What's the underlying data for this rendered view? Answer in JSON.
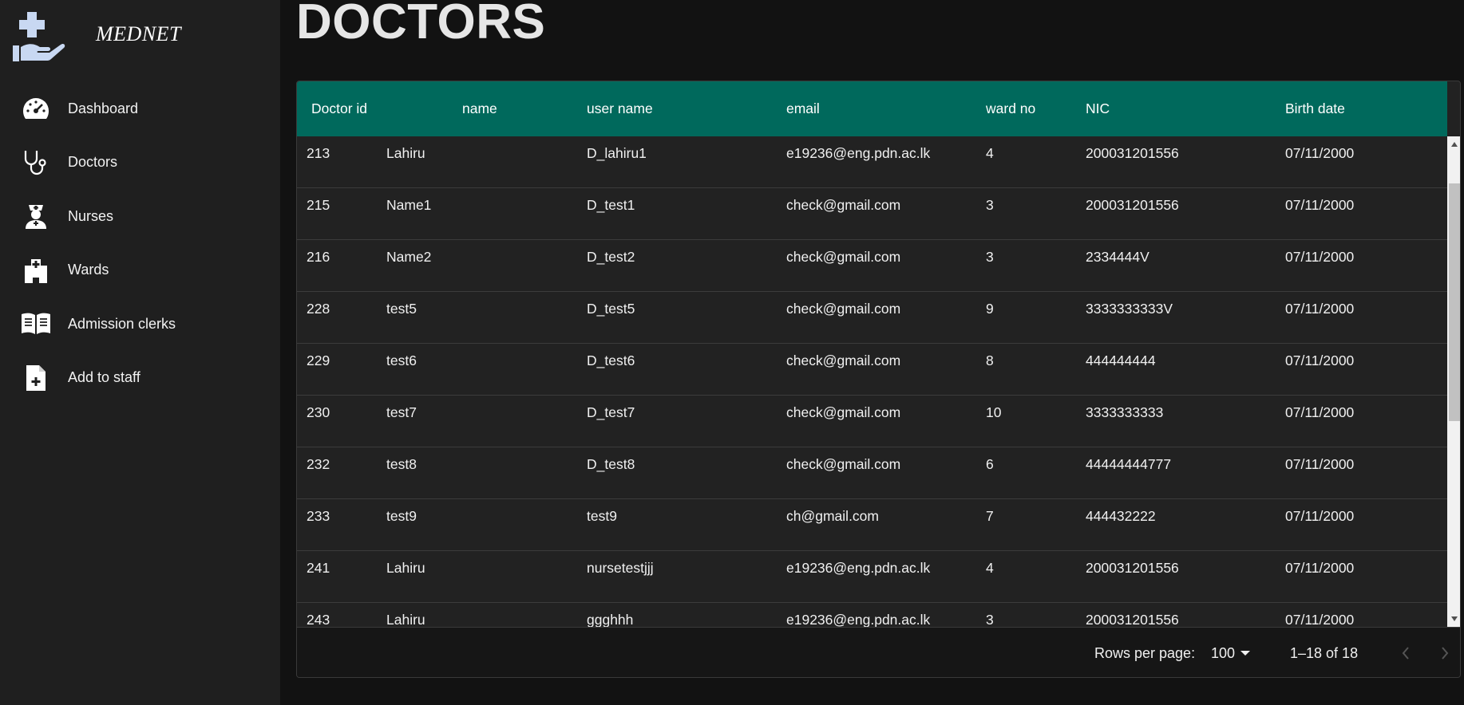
{
  "brand": {
    "name": "MEDNET"
  },
  "sidebar": {
    "items": [
      {
        "label": "Dashboard",
        "icon": "speedometer-icon"
      },
      {
        "label": "Doctors",
        "icon": "stethoscope-icon"
      },
      {
        "label": "Nurses",
        "icon": "nurse-icon"
      },
      {
        "label": "Wards",
        "icon": "hospital-icon"
      },
      {
        "label": "Admission clerks",
        "icon": "book-icon"
      },
      {
        "label": "Add to staff",
        "icon": "file-add-icon"
      }
    ]
  },
  "page": {
    "title": "DOCTORS"
  },
  "table": {
    "columns": [
      "Doctor id",
      "name",
      "user name",
      "email",
      "ward no",
      "NIC",
      "Birth date"
    ],
    "rows": [
      [
        "213",
        "Lahiru",
        "D_lahiru1",
        "e19236@eng.pdn.ac.lk",
        "4",
        "200031201556",
        "07/11/2000"
      ],
      [
        "215",
        "Name1",
        "D_test1",
        "check@gmail.com",
        "3",
        "200031201556",
        "07/11/2000"
      ],
      [
        "216",
        "Name2",
        "D_test2",
        "check@gmail.com",
        "3",
        "2334444V",
        "07/11/2000"
      ],
      [
        "228",
        "test5",
        "D_test5",
        "check@gmail.com",
        "9",
        "3333333333V",
        "07/11/2000"
      ],
      [
        "229",
        "test6",
        "D_test6",
        "check@gmail.com",
        "8",
        "444444444",
        "07/11/2000"
      ],
      [
        "230",
        "test7",
        "D_test7",
        "check@gmail.com",
        "10",
        "3333333333",
        "07/11/2000"
      ],
      [
        "232",
        "test8",
        "D_test8",
        "check@gmail.com",
        "6",
        "44444444777",
        "07/11/2000"
      ],
      [
        "233",
        "test9",
        "test9",
        "ch@gmail.com",
        "7",
        "444432222",
        "07/11/2000"
      ],
      [
        "241",
        "Lahiru",
        "nursetestjjj",
        "e19236@eng.pdn.ac.lk",
        "4",
        "200031201556",
        "07/11/2000"
      ],
      [
        "243",
        "Lahiru",
        "ggghhh",
        "e19236@eng.pdn.ac.lk",
        "3",
        "200031201556",
        "07/11/2000"
      ]
    ]
  },
  "footer": {
    "rows_per_page_label": "Rows per page:",
    "rows_per_page_value": "100",
    "range": "1–18 of 18"
  }
}
